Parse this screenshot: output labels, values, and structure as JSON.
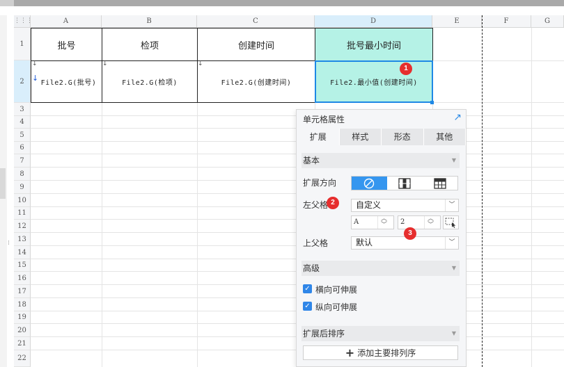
{
  "grid": {
    "columns": [
      "A",
      "B",
      "C",
      "D",
      "E",
      "F",
      "G"
    ],
    "rows": [
      "1",
      "2",
      "3",
      "4",
      "5",
      "6",
      "7",
      "8",
      "9",
      "10",
      "11",
      "12",
      "13",
      "14",
      "15",
      "16",
      "17",
      "18",
      "19",
      "20",
      "21",
      "22"
    ]
  },
  "cells": {
    "A1": "批号",
    "B1": "检项",
    "C1": "创建时间",
    "D1": "批号最小时间",
    "A2": "File2.G(批号)",
    "B2": "File2.G(检项)",
    "C2": "File2.G(创建时间)",
    "D2": "File2.最小值(创建时间)"
  },
  "badges": [
    "1",
    "2",
    "3"
  ],
  "panel": {
    "title": "单元格属性",
    "tabs": [
      "扩展",
      "样式",
      "形态",
      "其他"
    ],
    "sections": {
      "basic": "基本",
      "advanced": "高级",
      "sort": "扩展后排序"
    },
    "expand_direction_label": "扩展方向",
    "left_parent_label": "左父格",
    "left_parent_value": "自定义",
    "left_parent_col": "A",
    "left_parent_row": "2",
    "top_parent_label": "上父格",
    "top_parent_value": "默认",
    "checkbox_horizontal": "横向可伸展",
    "checkbox_vertical": "纵向可伸展",
    "add_sort_button": "添加主要排列序"
  },
  "colors": {
    "accent": "#3596ef",
    "highlight_cell": "#b5f2e6",
    "badge": "#e62e2e",
    "selection_border": "#1e88e5"
  }
}
